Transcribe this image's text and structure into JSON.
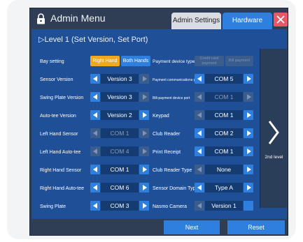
{
  "header": {
    "title": "Admin Menu",
    "tabs": [
      {
        "label": "Admin Settings",
        "active": false
      },
      {
        "label": "Hardware",
        "active": true
      }
    ]
  },
  "level": {
    "title": "▷Level 1 (Set Version, Set Port)",
    "next_level_label": "2nd level"
  },
  "left_rows": [
    {
      "label": "Bay setting",
      "type": "toggle",
      "options": [
        "Right Hand",
        "Both Hands"
      ],
      "selected": "Right Hand"
    },
    {
      "label": "Sensor Version",
      "value": "Version 3",
      "enabled": true
    },
    {
      "label": "Swing Plate Version",
      "value": "Version 3",
      "enabled": true
    },
    {
      "label": "Auto-tee Version",
      "value": "Version 2",
      "enabled": true
    },
    {
      "label": "Left Hand Sensor",
      "value": "COM 1",
      "enabled": false
    },
    {
      "label": "Left Hand Auto-tee",
      "value": "COM 4",
      "enabled": false
    },
    {
      "label": "Right Hand Sensor",
      "value": "COM 1",
      "enabled": true
    },
    {
      "label": "Right Hand Auto-tee",
      "value": "COM 6",
      "enabled": true
    },
    {
      "label": "Swing Plate",
      "value": "COM 3",
      "enabled": true
    }
  ],
  "right_rows": [
    {
      "label": "Payment device type",
      "type": "toggle",
      "options": [
        "Credit card payment",
        "Bill payment"
      ],
      "enabled": false
    },
    {
      "label": "Payment communications port",
      "value": "COM 5",
      "enabled": true
    },
    {
      "label": "Bill-payment device port",
      "value": "COM 1",
      "enabled": false
    },
    {
      "label": "Keypad",
      "value": "COM 1",
      "enabled": true
    },
    {
      "label": "Club Reader",
      "value": "COM 2",
      "enabled": true
    },
    {
      "label": "Print Receipt",
      "value": "COM 1",
      "enabled": true
    },
    {
      "label": "Club Reader Type",
      "value": "None",
      "enabled": true
    },
    {
      "label": "Sensor Domain Type",
      "value": "Type A",
      "enabled": true
    },
    {
      "label": "Nasmo Camera",
      "value": "Version 1",
      "enabled": true
    }
  ],
  "footer": {
    "next_label": "Next",
    "reset_label": "Reset"
  },
  "colors": {
    "accent": "#2f7fde",
    "active_toggle": "#f1a81c",
    "close": "#e85866"
  }
}
